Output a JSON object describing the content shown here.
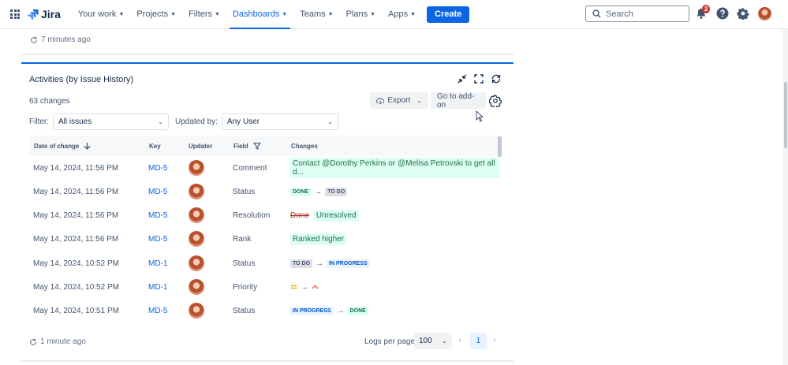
{
  "nav": {
    "logo": "Jira",
    "items": [
      {
        "label": "Your work"
      },
      {
        "label": "Projects"
      },
      {
        "label": "Filters"
      },
      {
        "label": "Dashboards"
      },
      {
        "label": "Teams"
      },
      {
        "label": "Plans"
      },
      {
        "label": "Apps"
      }
    ],
    "create_label": "Create",
    "search_placeholder": "Search",
    "notification_count": "2"
  },
  "prev_gadget": {
    "updated": "7 minutes ago"
  },
  "gadget": {
    "title": "Activities (by Issue History)",
    "changes_count": "63 changes",
    "export_label": "Export",
    "addon_label": "Go to add-on",
    "filter_label": "Filter:",
    "filter_value": "All issues",
    "updated_by_label": "Updated by:",
    "updated_by_value": "Any User",
    "columns": {
      "date": "Date of change",
      "key": "Key",
      "updater": "Updater",
      "field": "Field",
      "changes": "Changes"
    },
    "rows": [
      {
        "date": "May 14, 2024, 11:56 PM",
        "key": "MD-5",
        "field": "Comment",
        "change_text": "Contact @Dorothy Perkins or @Melisa Petrovski to get all d..."
      },
      {
        "date": "May 14, 2024, 11:56 PM",
        "key": "MD-5",
        "field": "Status",
        "from": "DONE",
        "to": "TO DO"
      },
      {
        "date": "May 14, 2024, 11:56 PM",
        "key": "MD-5",
        "field": "Resolution",
        "old": "Done",
        "new": "Unresolved"
      },
      {
        "date": "May 14, 2024, 11:56 PM",
        "key": "MD-5",
        "field": "Rank",
        "change_text": "Ranked higher"
      },
      {
        "date": "May 14, 2024, 10:52 PM",
        "key": "MD-1",
        "field": "Status",
        "from": "TO DO",
        "to": "IN PROGRESS"
      },
      {
        "date": "May 14, 2024, 10:52 PM",
        "key": "MD-1",
        "field": "Priority"
      },
      {
        "date": "May 14, 2024, 10:51 PM",
        "key": "MD-5",
        "field": "Status",
        "from": "IN PROGRESS",
        "to": "DONE"
      }
    ],
    "updated": "1 minute ago",
    "logs_per_page_label": "Logs per page:",
    "logs_per_page_value": "100",
    "current_page": "1"
  }
}
